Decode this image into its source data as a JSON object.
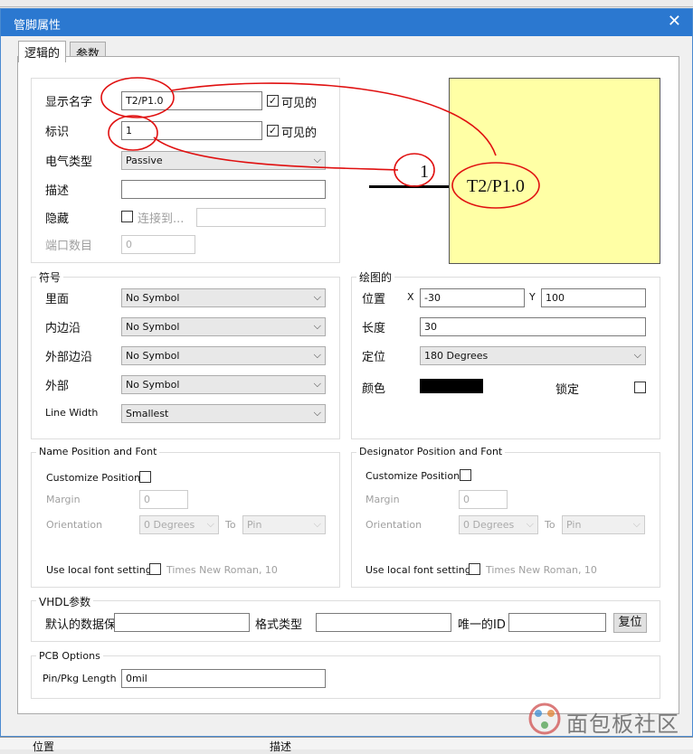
{
  "background": {
    "bottom_left": "位置",
    "bottom_right": "描述"
  },
  "dialog": {
    "title": "管脚属性",
    "close": "✕"
  },
  "tabs": [
    {
      "label": "逻辑的"
    },
    {
      "label": "参数"
    }
  ],
  "logical": {
    "display_name_label": "显示名字",
    "display_name_value": "T2/P1.0",
    "visible_label": "可见的",
    "designator_label": "标识",
    "designator_value": "1",
    "electrical_type_label": "电气类型",
    "electrical_type_value": "Passive",
    "description_label": "描述",
    "description_value": "",
    "hidden_label": "隐藏",
    "connect_to_label": "连接到...",
    "port_count_label": "端口数目",
    "port_count_value": "0"
  },
  "preview": {
    "pin_number": "1",
    "pin_name": "T2/P1.0"
  },
  "symbols": {
    "title": "符号",
    "rows": [
      {
        "label": "里面",
        "value": "No Symbol"
      },
      {
        "label": "内边沿",
        "value": "No Symbol"
      },
      {
        "label": "外部边沿",
        "value": "No Symbol"
      },
      {
        "label": "外部",
        "value": "No Symbol"
      },
      {
        "label": "Line Width",
        "value": "Smallest"
      }
    ]
  },
  "graphics": {
    "title": "绘图的",
    "position_label": "位置",
    "x_label": "X",
    "x_value": "-30",
    "y_label": "Y",
    "y_value": "100",
    "length_label": "长度",
    "length_value": "30",
    "orientation_label": "定位",
    "orientation_value": "180 Degrees",
    "color_label": "颜色",
    "color": "#000000",
    "lock_label": "锁定"
  },
  "name_font": {
    "title": "Name Position and Font",
    "customize_label": "Customize Position",
    "margin_label": "Margin",
    "margin_value": "0",
    "orientation_label": "Orientation",
    "orientation_value": "0 Degrees",
    "to_label": "To",
    "to_value": "Pin",
    "local_font_label": "Use local font setting",
    "font_value": "Times New Roman, 10"
  },
  "designator_font": {
    "title": "Designator Position and Font",
    "customize_label": "Customize Position",
    "margin_label": "Margin",
    "margin_value": "0",
    "orientation_label": "Orientation",
    "orientation_value": "0 Degrees",
    "to_label": "To",
    "to_value": "Pin",
    "local_font_label": "Use local font setting",
    "font_value": "Times New Roman, 10"
  },
  "vhdl": {
    "title": "VHDL参数",
    "default_label": "默认的数据保",
    "format_label": "格式类型",
    "unique_label": "唯一的ID",
    "reset_label": "复位"
  },
  "pcb": {
    "title": "PCB Options",
    "pin_length_label": "Pin/Pkg Length",
    "pin_length_value": "0mil"
  },
  "watermark": "面包板社区",
  "colors": {
    "titlebar": "#2b78d0",
    "preview_fill": "#ffffa5",
    "annotation": "#e01010"
  }
}
